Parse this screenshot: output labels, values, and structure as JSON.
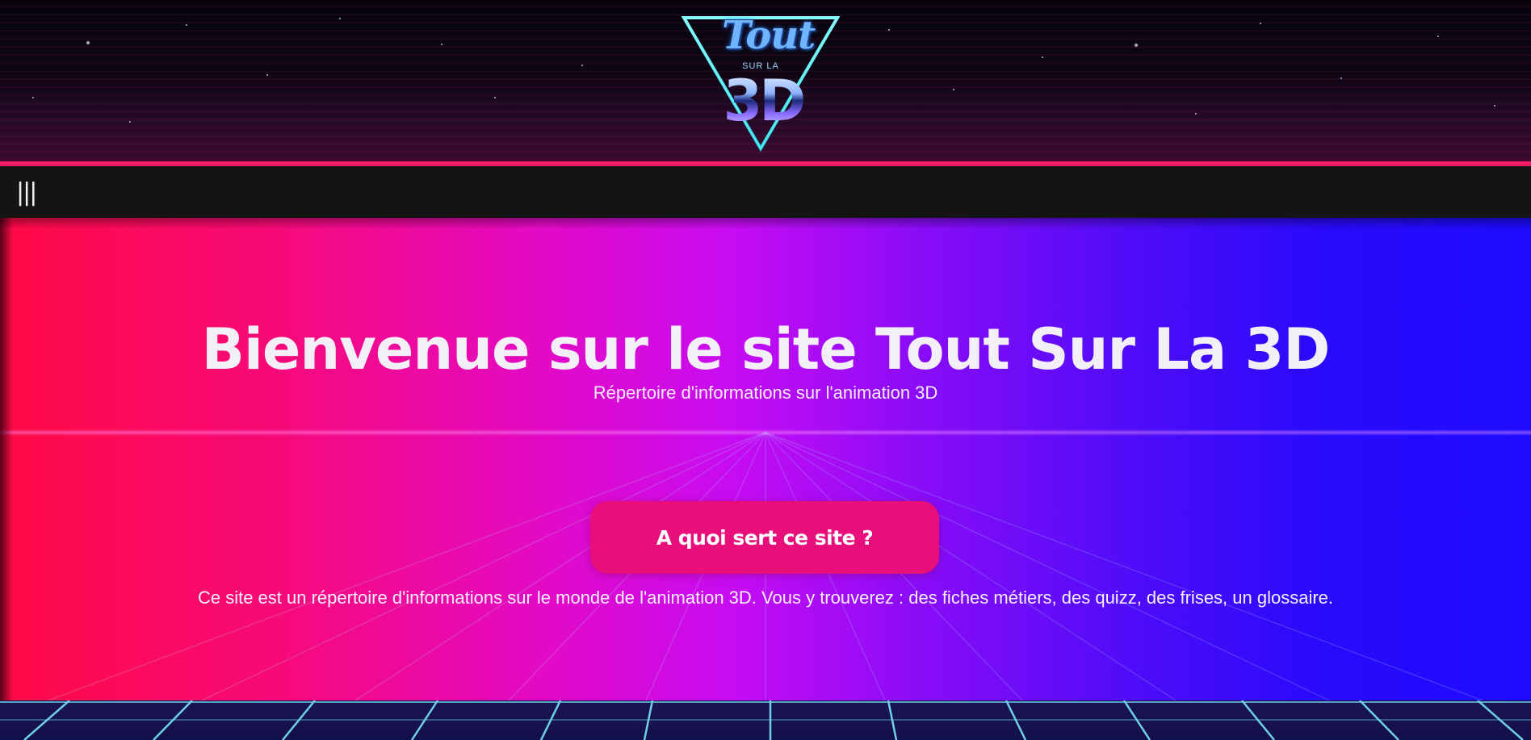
{
  "header": {
    "logo": {
      "word_top": "Tout",
      "word_middle": "SUR LA",
      "word_bottom": "3D"
    }
  },
  "nav": {
    "menu_icon_glyph": "|||"
  },
  "hero": {
    "title": "Bienvenue sur le site Tout Sur La 3D",
    "subtitle": "Répertoire d'informations sur l'animation 3D",
    "cta_label": "A quoi sert ce site ?",
    "description": "Ce site est un répertoire d'informations sur le monde de l'animation 3D. Vous y trouverez : des fiches métiers, des quizz, des frises, un glossaire."
  },
  "colors": {
    "accent_pink": "#ff1d6a",
    "button_pink": "#e80f7a",
    "nav_bg": "#141414",
    "gradient_start": "#ff0a45",
    "gradient_mid": "#c60cf2",
    "gradient_end": "#1d0bff",
    "grid_line": "#7ff2ff"
  },
  "icons": [
    "menu-icon",
    "logo-triangle-icon"
  ]
}
